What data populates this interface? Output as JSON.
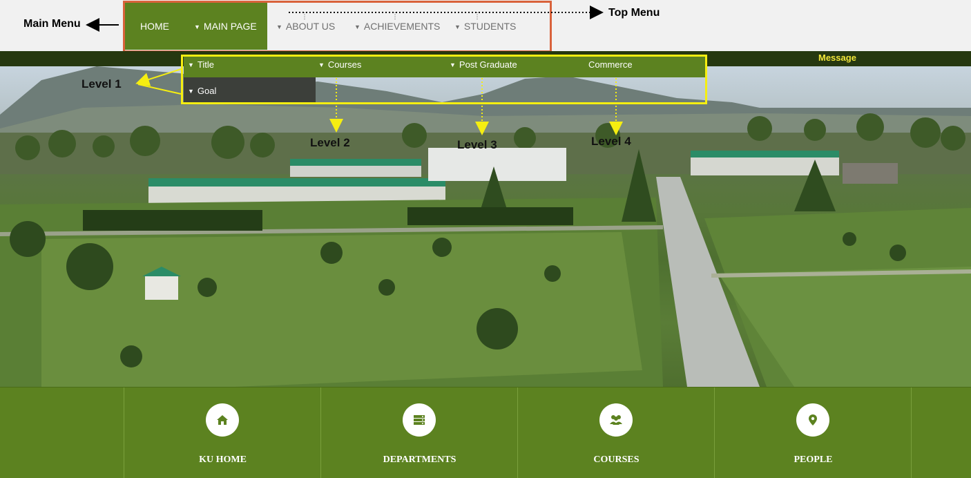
{
  "main_menu": [
    {
      "label": "HOME"
    },
    {
      "label": "MAIN PAGE"
    }
  ],
  "top_menu": [
    {
      "label": "ABOUT US"
    },
    {
      "label": "ACHIEVEMENTS"
    },
    {
      "label": "STUDENTS"
    }
  ],
  "annotations": {
    "main_menu": "Main Menu",
    "top_menu": "Top Menu",
    "level1": "Level 1",
    "level2": "Level 2",
    "level3": "Level 3",
    "level4": "Level 4"
  },
  "message": "Message",
  "mega_menu": {
    "items": [
      "Title",
      "Courses",
      "Post Graduate",
      "Commerce"
    ],
    "sub_item": "Goal"
  },
  "footer_tiles": [
    {
      "label": "KU HOME",
      "icon": "home-icon"
    },
    {
      "label": "DEPARTMENTS",
      "icon": "server-icon"
    },
    {
      "label": "COURSES",
      "icon": "users-icon"
    },
    {
      "label": "PEOPLE",
      "icon": "map-marker-icon"
    }
  ],
  "colors": {
    "brand_green": "#5c8220",
    "dark_strip": "#263810",
    "annotation_red": "#d9623b",
    "annotation_yellow": "#f5ee11",
    "message_yellow": "#f3e73a"
  }
}
